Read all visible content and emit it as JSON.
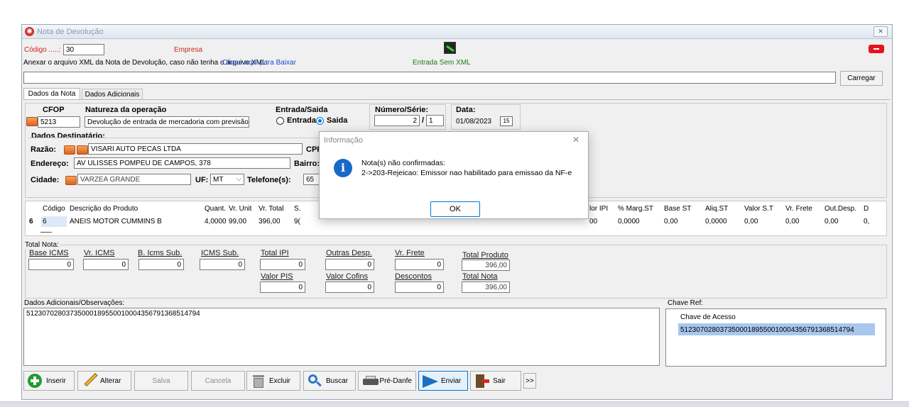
{
  "window": {
    "title": "Nota de Devolução",
    "close_label": "✕"
  },
  "header": {
    "codigo_label": "Código .....:",
    "codigo_value": "30",
    "empresa_label": "Empresa",
    "anexar_text": "Anexar o arquivo XML da Nota de Devolução, caso não tenha o arquivo XML:",
    "download_link": "Clique aqui para Baixar",
    "entrada_sem_xml": "Entrada Sem XML",
    "xml_path_value": "",
    "carregar_label": "Carregar"
  },
  "tabs": [
    {
      "label": "Dados da Nota",
      "active": true
    },
    {
      "label": "Dados Adicionais",
      "active": false
    }
  ],
  "nota": {
    "cfop_label": "CFOP",
    "cfop_value": "5213",
    "natureza_label": "Natureza da operação",
    "natureza_value": "Devolução de entrada de mercadoria com previsão de po",
    "entrada_saida_label": "Entrada/Saida",
    "entrada_option": "Entrada",
    "saida_option": "Saida",
    "selected": "Saida",
    "numero_serie_label": "Número/Série:",
    "numero_value": "2",
    "serie_separator": "/",
    "serie_value": "1",
    "data_label": "Data:",
    "data_value": "01/08/2023",
    "calendar_label": "15"
  },
  "destinatario": {
    "section_label": "Dados Destinatário:",
    "razao_label": "Razão:",
    "razao_value": "VISARI  AUTO PECAS LTDA",
    "cpf_label": "CPF",
    "endereco_label": "Endereço:",
    "endereco_value": "AV ULISSES POMPEU DE CAMPOS, 378",
    "bairro_label": "Bairro:",
    "cidade_label": "Cidade:",
    "cidade_value": "VARZEA GRANDE",
    "uf_label": "UF:",
    "uf_value": "MT",
    "telefone_label": "Telefone(s):",
    "telefone_value": "65"
  },
  "products": {
    "row_indicator": "6",
    "left_columns": [
      "Código",
      "Descrição do Produto",
      "Quant.",
      "Vr. Unit",
      "Vr. Total",
      "S."
    ],
    "right_columns": [
      "lor IPI",
      "% Marg.ST",
      "Base ST",
      "Aliq.ST",
      "Valor S.T",
      "Vr. Frete",
      "Out.Desp.",
      "D"
    ],
    "rows": [
      {
        "left": [
          "6",
          "ANEIS MOTOR CUMMINS B",
          "4,0000",
          "99,00",
          "396,00",
          "9("
        ],
        "right": [
          "00",
          "0,0000",
          "0,00",
          "0,0000",
          "0,00",
          "0,00",
          "0,00",
          "0,"
        ]
      }
    ]
  },
  "totals": {
    "section_label": "Total Nota:",
    "base_icms_label": "Base ICMS",
    "base_icms_value": "0",
    "vr_icms_label": "Vr. ICMS",
    "vr_icms_value": "0",
    "b_icms_sub_label": "B. Icms Sub.",
    "b_icms_sub_value": "0",
    "icms_sub_label": "ICMS Sub.",
    "icms_sub_value": "0",
    "total_ipi_label": "Total IPI",
    "total_ipi_value": "0",
    "outras_desp_label": "Outras Desp.",
    "outras_desp_value": "0",
    "vr_frete_label": "Vr. Frete",
    "vr_frete_value": "0",
    "total_produto_label": "Total Produto",
    "total_produto_value": "396,00",
    "valor_pis_label": "Valor PIS",
    "valor_pis_value": "0",
    "valor_cofins_label": "Valor Cofins",
    "valor_cofins_value": "0",
    "descontos_label": "Descontos",
    "descontos_value": "0",
    "total_nota_label": "Total Nota",
    "total_nota_value": "396,00"
  },
  "adicionais": {
    "label": "Dados Adicionais/Observações:",
    "text": "51230702803735000189550010004356791368514794"
  },
  "chave_ref": {
    "label": "Chave Ref:",
    "column": "Chave de Acesso",
    "value": "51230702803735000189550010004356791368514794"
  },
  "toolbar": {
    "inserir": "Inserir",
    "alterar": "Alterar",
    "salva": "Salva",
    "cancela": "Cancela",
    "excluir": "Excluir",
    "buscar": "Buscar",
    "pre_danfe": "Pré-Danfe",
    "enviar": "Enviar",
    "sair": "Sair",
    "more": ">>"
  },
  "dialog": {
    "title": "Informação",
    "close": "✕",
    "line1": "Nota(s) não confirmadas:",
    "line2": "2->203-Rejeicao: Emissor nao habilitado para emissao da NF-e",
    "ok": "OK"
  },
  "colors": {
    "accent_blue": "#0078d7",
    "link_blue": "#1a4bd6",
    "empresa_red": "#c8281e",
    "entrada_green": "#1d7a1d",
    "selection": "#a8c7ef"
  }
}
